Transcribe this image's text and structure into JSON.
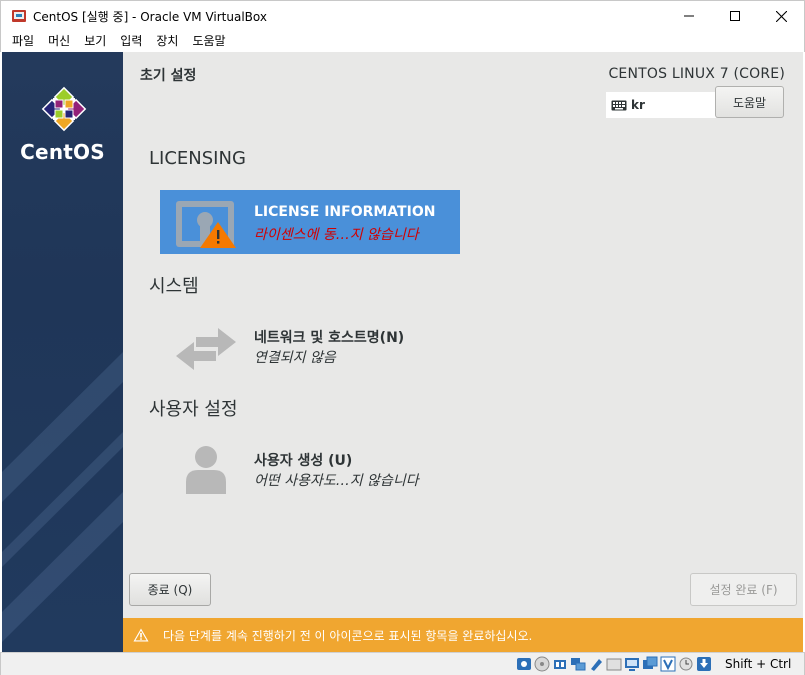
{
  "window": {
    "title": "CentOS [실행 중] - Oracle VM VirtualBox",
    "app_icon": "virtualbox-icon",
    "controls": [
      "minimize-icon",
      "maximize-icon",
      "close-icon"
    ]
  },
  "menubar": {
    "items": [
      "파일",
      "머신",
      "보기",
      "입력",
      "장치",
      "도움말"
    ]
  },
  "installer": {
    "brand": "CentOS",
    "page_title": "초기 설정",
    "os_name": "CENTOS LINUX 7 (CORE)",
    "keyboard_layout": "kr",
    "help_label": "도움말",
    "sections": [
      {
        "title": "LICENSING",
        "spokes": [
          {
            "title": "LICENSE INFORMATION",
            "status": "라이센스에 동…지 않습니다",
            "icon": "license-warning-icon",
            "selected": true
          }
        ]
      },
      {
        "title": "시스템",
        "spokes": [
          {
            "title": "네트워크 및 호스트명(N)",
            "status": "연결되지 않음",
            "icon": "network-arrows-icon",
            "selected": false
          }
        ]
      },
      {
        "title": "사용자 설정",
        "spokes": [
          {
            "title": "사용자 생성 (U)",
            "status": "어떤 사용자도…지 않습니다",
            "icon": "user-icon",
            "selected": false
          }
        ]
      }
    ],
    "quit_label": "종료 (Q)",
    "finish_label": "설정 완료 (F)",
    "warning_text": "다음 단계를 계속 진행하기 전 이 아이콘으로 표시된 항목을 완료하십시오."
  },
  "statusbar": {
    "host_key": "Shift + Ctrl",
    "icons": [
      "hard-disk-icon",
      "optical-drive-icon",
      "audio-icon",
      "network-icon",
      "usb-icon",
      "shared-folder-icon",
      "display-icon",
      "recording-icon",
      "virtualization-icon",
      "mouse-integration-icon",
      "host-key-arrow-icon"
    ]
  },
  "colors": {
    "sidebar": "#213a5e",
    "selected_spoke": "#4a90d9",
    "warning_bar": "#f0a630",
    "warning_status_text": "#d00000",
    "background": "#e8e8e7"
  }
}
